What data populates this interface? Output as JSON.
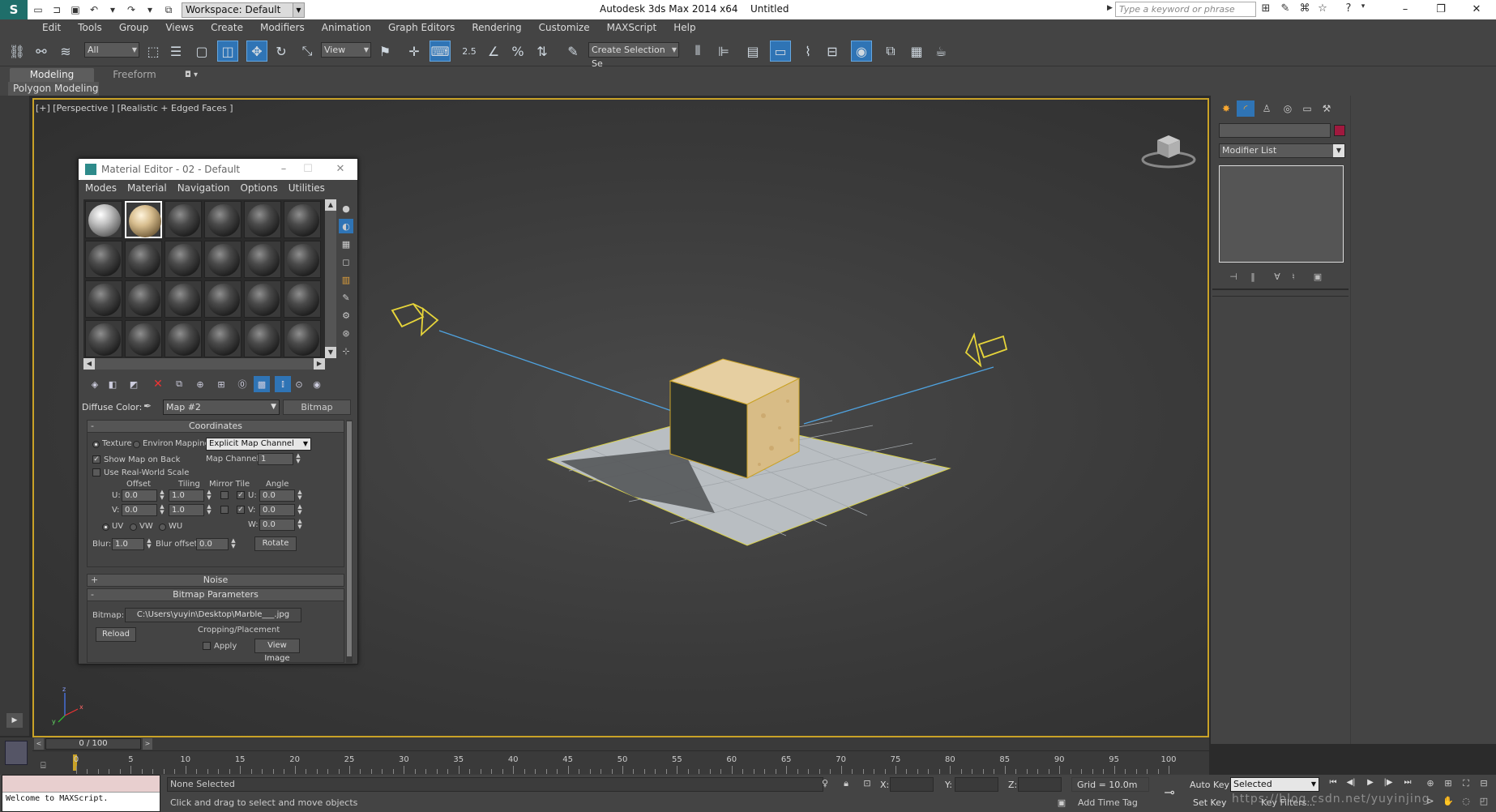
{
  "titlebar": {
    "workspace": "Workspace: Default",
    "app_title": "Autodesk 3ds Max  2014 x64",
    "doc_title": "Untitled",
    "search_placeholder": "Type a keyword or phrase",
    "minimize": "–",
    "restore": "❐",
    "close": "✕"
  },
  "menu": [
    "Edit",
    "Tools",
    "Group",
    "Views",
    "Create",
    "Modifiers",
    "Animation",
    "Graph Editors",
    "Rendering",
    "Customize",
    "MAXScript",
    "Help"
  ],
  "toolbar": {
    "selection_filter": "All",
    "ref_coord": "View",
    "named_selection": "Create Selection Se",
    "snap_angle_label": "2.5"
  },
  "ribbon": {
    "tabs": [
      "Modeling",
      "Freeform"
    ],
    "active_tab": "Modeling",
    "panel": "Polygon Modeling",
    "options_glyph": "◘ ▾"
  },
  "viewport": {
    "label": "[+] [Perspective ] [Realistic + Edged Faces ]",
    "border_color": "#c9a227",
    "axis": {
      "x": "x",
      "y": "y",
      "z": "z"
    }
  },
  "material_editor": {
    "title": "Material Editor - 02 - Default",
    "menus": [
      "Modes",
      "Material",
      "Navigation",
      "Options",
      "Utilities"
    ],
    "diffuse_label": "Diffuse Color:",
    "map_name": "Map #2",
    "map_type": "Bitmap",
    "coordinates": {
      "header": "Coordinates",
      "texture": "Texture",
      "environ": "Environ",
      "mapping_label": "Mapping:",
      "mapping_value": "Explicit Map Channel",
      "show_map_on_back": "Show Map on Back",
      "map_channel_label": "Map Channel:",
      "map_channel_value": "1",
      "use_real_world": "Use Real-World Scale",
      "col_offset": "Offset",
      "col_tiling": "Tiling",
      "col_mirror_tile": "Mirror Tile",
      "col_angle": "Angle",
      "u_label": "U:",
      "v_label": "V:",
      "w_label": "W:",
      "u_offset": "0.0",
      "v_offset": "0.0",
      "u_tiling": "1.0",
      "v_tiling": "1.0",
      "u_angle": "0.0",
      "v_angle": "0.0",
      "w_angle": "0.0",
      "uv": "UV",
      "vw": "VW",
      "wu": "WU",
      "blur_label": "Blur:",
      "blur_value": "1.0",
      "blur_offset_label": "Blur offset:",
      "blur_offset_value": "0.0",
      "rotate": "Rotate"
    },
    "noise_header": "Noise",
    "bitmap_params": {
      "header": "Bitmap Parameters",
      "bitmap_label": "Bitmap:",
      "bitmap_path": "C:\\Users\\yuyin\\Desktop\\Marble___.jpg",
      "reload": "Reload",
      "cropping": "Cropping/Placement",
      "apply": "Apply",
      "view_image": "View Image"
    }
  },
  "command_panel": {
    "modifier_list": "Modifier List",
    "object_color": "#a0193e"
  },
  "timeline": {
    "frame_display": "0 / 100",
    "ticks": [
      "0",
      "5",
      "10",
      "15",
      "20",
      "25",
      "30",
      "35",
      "40",
      "45",
      "50",
      "55",
      "60",
      "65",
      "70",
      "75",
      "80",
      "85",
      "90",
      "95",
      "100"
    ]
  },
  "status": {
    "listener_text": "Welcome to MAXScript.",
    "selection": "None Selected",
    "prompt": "Click and drag to select and move objects",
    "x_label": "X:",
    "y_label": "Y:",
    "z_label": "Z:",
    "grid": "Grid = 10.0m",
    "add_time_tag": "Add Time Tag",
    "auto_key": "Auto Key",
    "set_key": "Set Key",
    "selected_dd": "Selected",
    "key_filters": "Key Filters...",
    "watermark": "https://blog.csdn.net/yuyinjing"
  }
}
